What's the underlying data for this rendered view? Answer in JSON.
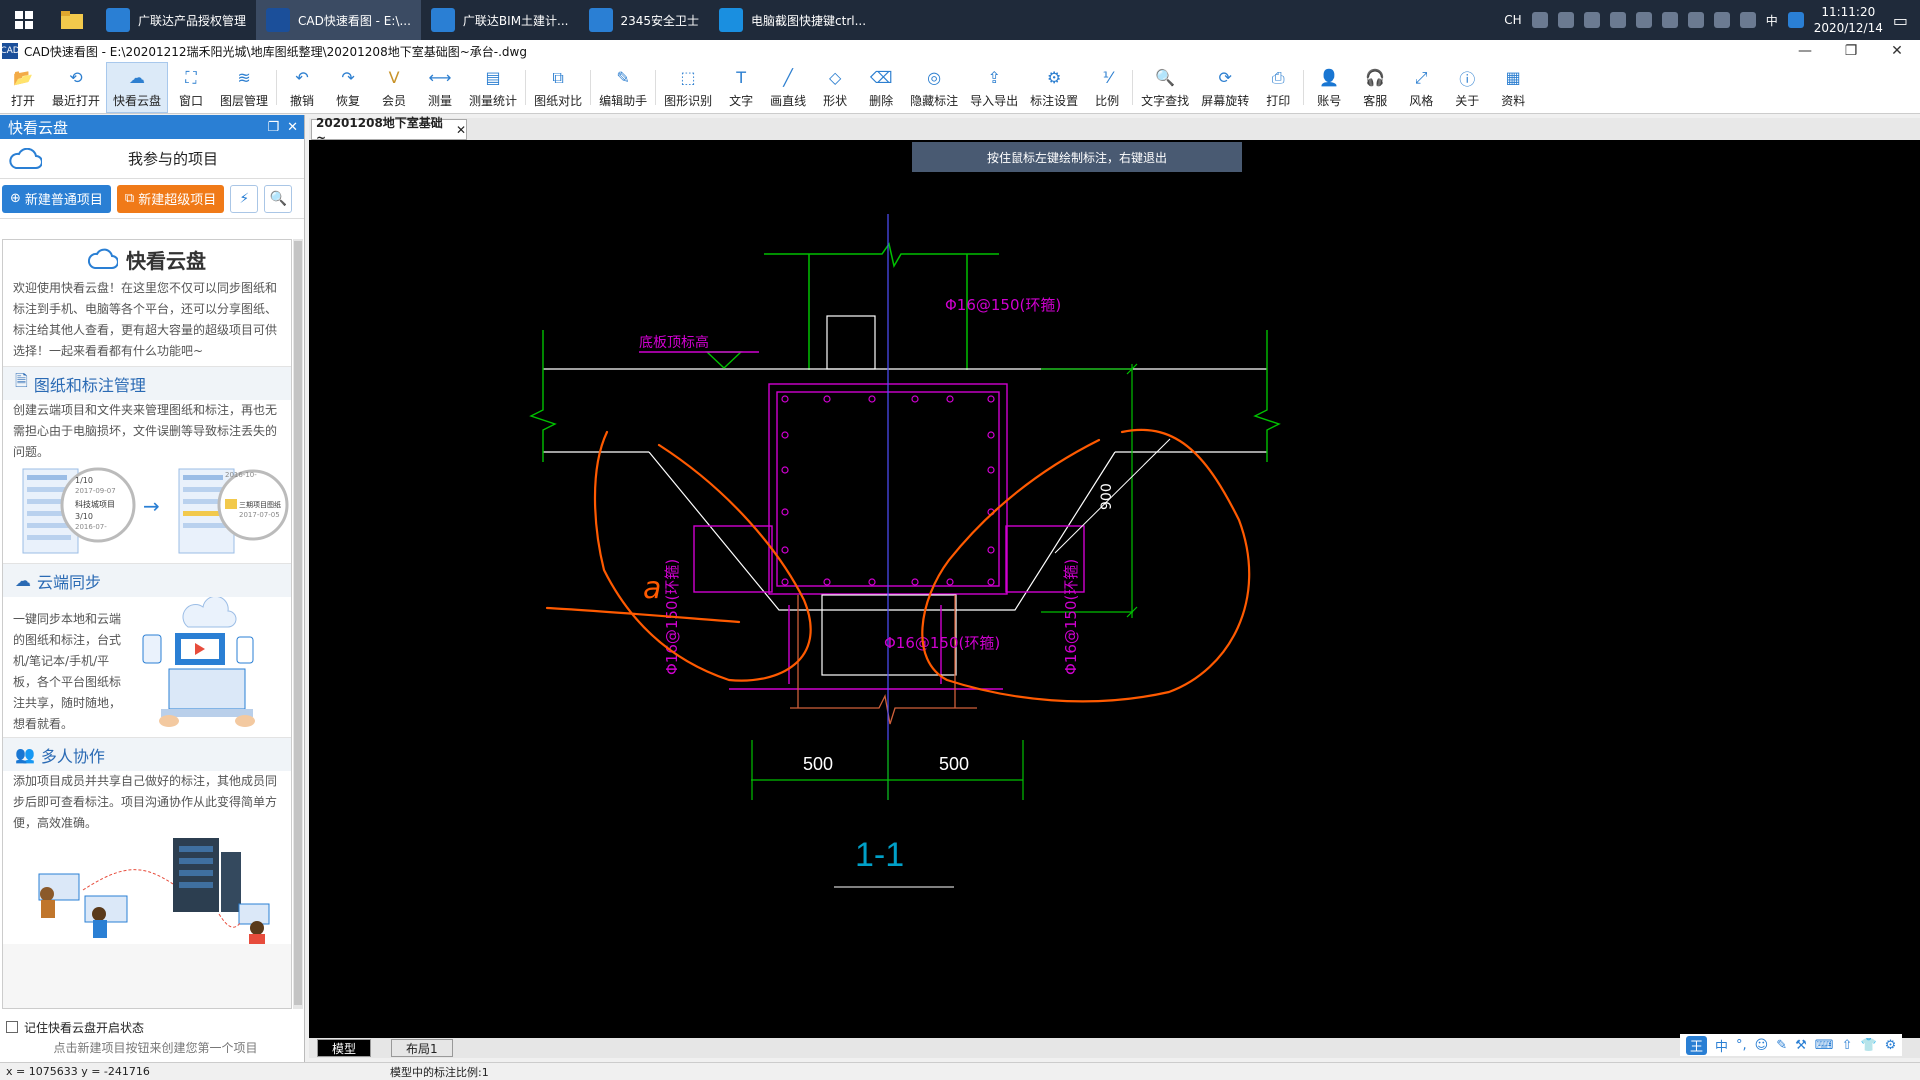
{
  "taskbar": {
    "apps": [
      {
        "label": "广联达产品授权管理",
        "icon": "gld-auth-icon",
        "color": "#2a7fd4"
      },
      {
        "label": "CAD快速看图 - E:\\...",
        "icon": "cad-icon",
        "color": "#1b4f9a"
      },
      {
        "label": "广联达BIM土建计...",
        "icon": "gld-bim-icon",
        "color": "#2a7fd4"
      },
      {
        "label": "2345安全卫士",
        "icon": "shield-icon",
        "color": "#2a7fd4"
      },
      {
        "label": "电脑截图快捷键ctrl...",
        "icon": "browser-icon",
        "color": "#1a8fe0"
      }
    ],
    "tray_lang": "CH",
    "tray_ime": "中",
    "time": "11:11:20",
    "date": "2020/12/14"
  },
  "window": {
    "title": "CAD快速看图 - E:\\20201212瑞禾阳光城\\地库图纸整理\\20201208地下室基础图~承台-.dwg"
  },
  "toolbar": [
    {
      "name": "open",
      "label": "打开",
      "glyph": "📂"
    },
    {
      "name": "recent-open",
      "label": "最近打开",
      "glyph": "⟲"
    },
    {
      "name": "cloud-disk",
      "label": "快看云盘",
      "glyph": "☁",
      "active": true
    },
    {
      "name": "window",
      "label": "窗口",
      "glyph": "⛶"
    },
    {
      "name": "layer-manage",
      "label": "图层管理",
      "glyph": "≋"
    },
    {
      "sep": true
    },
    {
      "name": "undo",
      "label": "撤销",
      "glyph": "↶"
    },
    {
      "name": "redo",
      "label": "恢复",
      "glyph": "↷"
    },
    {
      "name": "vip",
      "label": "会员",
      "glyph": "V"
    },
    {
      "name": "measure",
      "label": "测量",
      "glyph": "⟷"
    },
    {
      "name": "measure-stats",
      "label": "测量统计",
      "glyph": "▤"
    },
    {
      "sep": true
    },
    {
      "name": "compare",
      "label": "图纸对比",
      "glyph": "⧉"
    },
    {
      "sep": true
    },
    {
      "name": "edit-assistant",
      "label": "编辑助手",
      "glyph": "✎"
    },
    {
      "sep": true
    },
    {
      "name": "shape-recognize",
      "label": "图形识别",
      "glyph": "⬚"
    },
    {
      "name": "text",
      "label": "文字",
      "glyph": "T"
    },
    {
      "name": "draw-line",
      "label": "画直线",
      "glyph": "╱"
    },
    {
      "name": "shape",
      "label": "形状",
      "glyph": "◇"
    },
    {
      "name": "delete",
      "label": "删除",
      "glyph": "⌫"
    },
    {
      "name": "hide-mark",
      "label": "隐藏标注",
      "glyph": "◎"
    },
    {
      "name": "import-export",
      "label": "导入导出",
      "glyph": "⇪"
    },
    {
      "name": "mark-settings",
      "label": "标注设置",
      "glyph": "⚙"
    },
    {
      "name": "scale",
      "label": "比例",
      "glyph": "⅟"
    },
    {
      "sep": true
    },
    {
      "name": "text-search",
      "label": "文字查找",
      "glyph": "🔍"
    },
    {
      "name": "screen-rotate",
      "label": "屏幕旋转",
      "glyph": "⟳"
    },
    {
      "name": "print",
      "label": "打印",
      "glyph": "⎙"
    },
    {
      "sep": true
    },
    {
      "name": "account",
      "label": "账号",
      "glyph": "👤"
    },
    {
      "name": "service",
      "label": "客服",
      "glyph": "🎧"
    },
    {
      "name": "style",
      "label": "风格",
      "glyph": "⤢"
    },
    {
      "name": "about",
      "label": "关于",
      "glyph": "ⓘ"
    },
    {
      "name": "materials",
      "label": "资料",
      "glyph": "▦"
    }
  ],
  "left_panel": {
    "header": "快看云盘",
    "project_title": "我参与的项目",
    "btn_new_normal": "新建普通项目",
    "btn_new_super": "新建超级项目",
    "cloud_title": "快看云盘",
    "intro": "欢迎使用快看云盘！在这里您不仅可以同步图纸和标注到手机、电脑等各个平台，还可以分享图纸、标注给其他人查看，更有超大容量的超级项目可供选择！一起来看看都有什么功能吧~",
    "sections": [
      {
        "title": "图纸和标注管理",
        "text": "创建云端项目和文件夹来管理图纸和标注，再也无需担心由于电脑损坏，文件误删等导致标注丢失的问题。",
        "illus_labels": [
          "1/10",
          "2017-09-07",
          "科技城项目",
          "3/10",
          "2016-07-",
          "2016-10-",
          "三期项目图纸",
          "2017-07-05"
        ]
      },
      {
        "title": "云端同步",
        "text": "一键同步本地和云端的图纸和标注，台式机/笔记本/手机/平板，各个平台图纸标注共享，随时随地，想看就看。"
      },
      {
        "title": "多人协作",
        "text": "添加项目成员并共享自己做好的标注，其他成员同步后即可查看标注。项目沟通协作从此变得简单方便，高效准确。"
      }
    ],
    "remember_label": "记住快看云盘开启状态",
    "footer_hint": "点击新建项目按钮来创建您第一个项目"
  },
  "doc_tab": "20201208地下室基础~",
  "canvas": {
    "hint": "按住鼠标左键绘制标注，右键退出",
    "labels": {
      "rebar_top": "Φ16@150(环箍)",
      "rebar_left": "Φ16@150(环箍)",
      "rebar_right": "Φ16@150(环箍)",
      "rebar_bottom": "Φ16@150(环箍)",
      "slab_level": "底板顶标高",
      "dim_900": "900",
      "dim_500_left": "500",
      "dim_500_right": "500",
      "section": "1-1",
      "handwriting": "a"
    }
  },
  "bottom_tabs": [
    "模型",
    "布局1"
  ],
  "ime": [
    "王",
    "中",
    "°,",
    "☺",
    "✎",
    "⚒",
    "⌨",
    "⇧",
    "👕",
    "⚙"
  ],
  "status": {
    "coords": "x = 1075633  y = -241716",
    "scale": "模型中的标注比例:1"
  },
  "colors": {
    "accent": "#2a7fd4",
    "orange": "#f07a18",
    "cad_bg": "#000000",
    "cad_green": "#00c000",
    "cad_magenta": "#d000d0",
    "cad_white": "#ffffff",
    "cad_orange_ink": "#ff5a00",
    "cad_cyan": "#00a0c8"
  }
}
